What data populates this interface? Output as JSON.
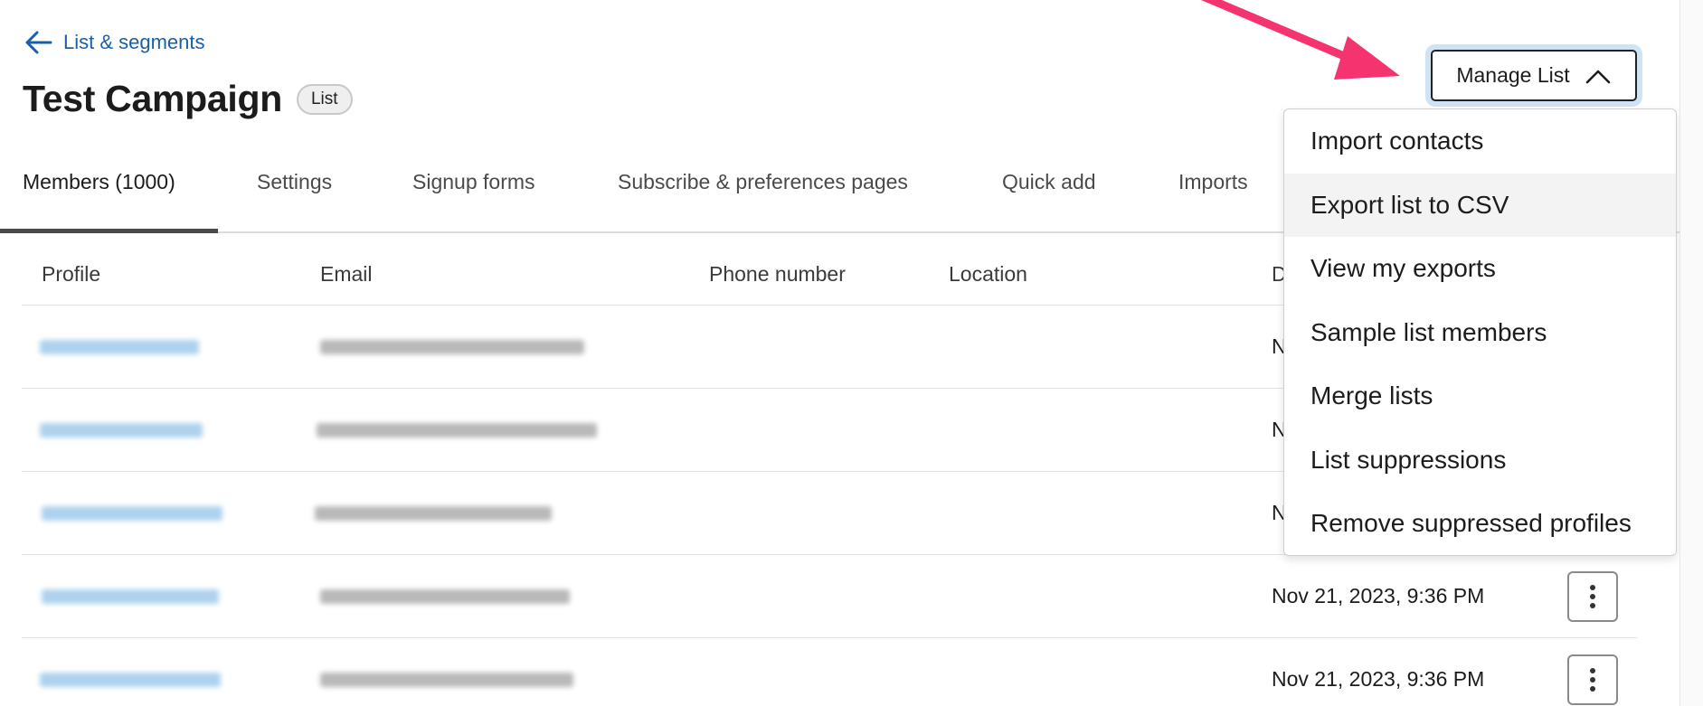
{
  "breadcrumb": {
    "label": "List & segments"
  },
  "page": {
    "title": "Test Campaign",
    "badge": "List"
  },
  "tabs": [
    {
      "label": "Members (1000)",
      "active": true
    },
    {
      "label": "Settings"
    },
    {
      "label": "Signup forms"
    },
    {
      "label": "Subscribe & preferences pages"
    },
    {
      "label": "Quick add"
    },
    {
      "label": "Imports"
    }
  ],
  "table": {
    "headers": [
      "Profile",
      "Email",
      "Phone number",
      "Location",
      "D"
    ],
    "rows": [
      {
        "date": "N"
      },
      {
        "date": "N"
      },
      {
        "date": "N"
      },
      {
        "date": "Nov 21, 2023, 9:36 PM"
      },
      {
        "date": "Nov 21, 2023, 9:36 PM"
      }
    ]
  },
  "manage_list": {
    "label": "Manage List"
  },
  "menu": {
    "items": [
      "Import contacts",
      "Export list to CSV",
      "View my exports",
      "Sample list members",
      "Merge lists",
      "List suppressions",
      "Remove suppressed profiles"
    ]
  },
  "colors": {
    "accent": "#1a5fa8",
    "arrow": "#f5336e",
    "focus_ring": "#cfe3f6"
  },
  "icons": {
    "back": "arrow-left-icon",
    "chevron": "chevron-up-icon",
    "kebab": "kebab-menu-icon"
  }
}
